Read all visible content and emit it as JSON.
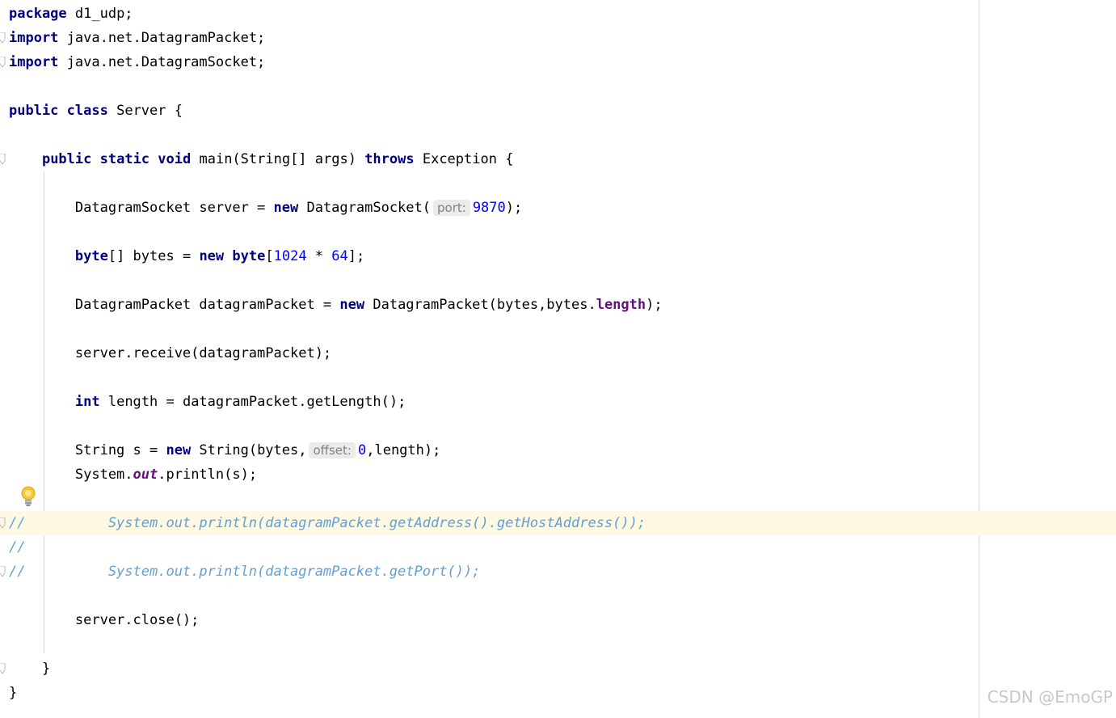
{
  "editor": {
    "lines": [
      {
        "tokens": [
          {
            "t": "package",
            "c": "keyword"
          },
          {
            "t": " d1_udp;",
            "c": "plain"
          }
        ]
      },
      {
        "tokens": [
          {
            "t": "import",
            "c": "keyword"
          },
          {
            "t": " java.net.DatagramPacket;",
            "c": "plain"
          }
        ]
      },
      {
        "tokens": [
          {
            "t": "import",
            "c": "keyword"
          },
          {
            "t": " java.net.DatagramSocket;",
            "c": "plain"
          }
        ]
      },
      {
        "tokens": []
      },
      {
        "tokens": [
          {
            "t": "public",
            "c": "keyword"
          },
          {
            "t": " ",
            "c": "plain"
          },
          {
            "t": "class",
            "c": "keyword"
          },
          {
            "t": " Server {",
            "c": "plain"
          }
        ]
      },
      {
        "tokens": []
      },
      {
        "tokens": [
          {
            "t": "    ",
            "c": "plain"
          },
          {
            "t": "public",
            "c": "keyword"
          },
          {
            "t": " ",
            "c": "plain"
          },
          {
            "t": "static",
            "c": "keyword"
          },
          {
            "t": " ",
            "c": "plain"
          },
          {
            "t": "void",
            "c": "keyword"
          },
          {
            "t": " main(String[] args) ",
            "c": "plain"
          },
          {
            "t": "throws",
            "c": "keyword"
          },
          {
            "t": " Exception {",
            "c": "plain"
          }
        ]
      },
      {
        "tokens": []
      },
      {
        "tokens": [
          {
            "t": "        DatagramSocket server = ",
            "c": "plain"
          },
          {
            "t": "new",
            "c": "keyword"
          },
          {
            "t": " DatagramSocket(",
            "c": "plain"
          },
          {
            "t": "port:",
            "c": "hint"
          },
          {
            "t": "9870",
            "c": "number"
          },
          {
            "t": ");",
            "c": "plain"
          }
        ]
      },
      {
        "tokens": []
      },
      {
        "tokens": [
          {
            "t": "        ",
            "c": "plain"
          },
          {
            "t": "byte",
            "c": "keyword"
          },
          {
            "t": "[] bytes = ",
            "c": "plain"
          },
          {
            "t": "new",
            "c": "keyword"
          },
          {
            "t": " ",
            "c": "plain"
          },
          {
            "t": "byte",
            "c": "keyword"
          },
          {
            "t": "[",
            "c": "plain"
          },
          {
            "t": "1024",
            "c": "number"
          },
          {
            "t": " * ",
            "c": "plain"
          },
          {
            "t": "64",
            "c": "number"
          },
          {
            "t": "];",
            "c": "plain"
          }
        ]
      },
      {
        "tokens": []
      },
      {
        "tokens": [
          {
            "t": "        DatagramPacket datagramPacket = ",
            "c": "plain"
          },
          {
            "t": "new",
            "c": "keyword"
          },
          {
            "t": " DatagramPacket(bytes,bytes.",
            "c": "plain"
          },
          {
            "t": "length",
            "c": "field"
          },
          {
            "t": ");",
            "c": "plain"
          }
        ]
      },
      {
        "tokens": []
      },
      {
        "tokens": [
          {
            "t": "        server.receive(datagramPacket);",
            "c": "plain"
          }
        ]
      },
      {
        "tokens": []
      },
      {
        "tokens": [
          {
            "t": "        ",
            "c": "plain"
          },
          {
            "t": "int",
            "c": "keyword"
          },
          {
            "t": " length = datagramPacket.getLength();",
            "c": "plain"
          }
        ]
      },
      {
        "tokens": []
      },
      {
        "tokens": [
          {
            "t": "        String s = ",
            "c": "plain"
          },
          {
            "t": "new",
            "c": "keyword"
          },
          {
            "t": " String(bytes,",
            "c": "plain"
          },
          {
            "t": "offset:",
            "c": "hint"
          },
          {
            "t": "0",
            "c": "number"
          },
          {
            "t": ",length);",
            "c": "plain"
          }
        ]
      },
      {
        "tokens": [
          {
            "t": "        System.",
            "c": "plain"
          },
          {
            "t": "out",
            "c": "static"
          },
          {
            "t": ".println(s);",
            "c": "plain"
          }
        ]
      },
      {
        "tokens": []
      },
      {
        "highlight": true,
        "tokens": [
          {
            "t": "//          System.out.println(datagramPacket.getAddress().getHostAddress());",
            "c": "comment"
          }
        ]
      },
      {
        "tokens": [
          {
            "t": "//",
            "c": "comment"
          }
        ]
      },
      {
        "tokens": [
          {
            "t": "//          System.out.println(datagramPacket.getPort());",
            "c": "comment"
          }
        ]
      },
      {
        "tokens": []
      },
      {
        "tokens": [
          {
            "t": "        server.close();",
            "c": "plain"
          }
        ]
      },
      {
        "tokens": []
      },
      {
        "tokens": [
          {
            "t": "    }",
            "c": "plain"
          }
        ]
      },
      {
        "tokens": [
          {
            "t": "}",
            "c": "plain"
          }
        ]
      }
    ]
  },
  "gutter": {
    "fold_icon": "fold-marker-icon",
    "fold_lines": [
      1,
      2,
      6,
      21,
      23,
      27
    ],
    "intention_icon": "lightbulb-icon"
  },
  "watermark": {
    "text": "CSDN @EmoGP"
  }
}
